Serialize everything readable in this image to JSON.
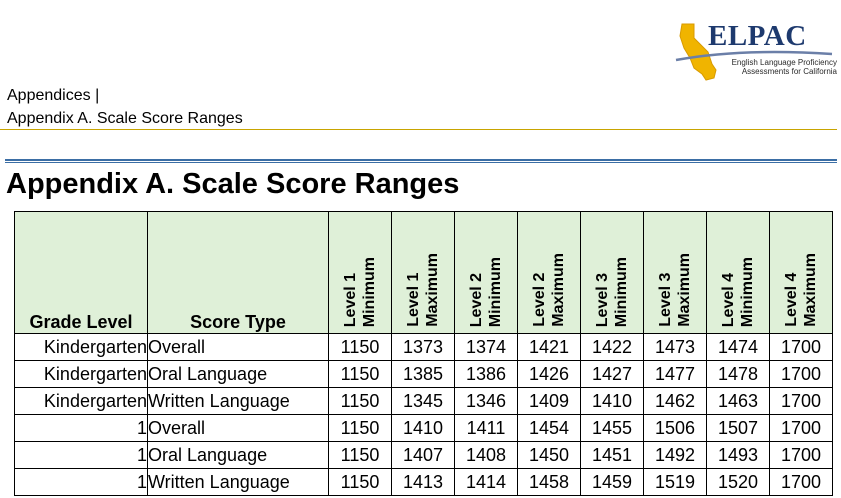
{
  "logo": {
    "name": "ELPAC",
    "subtitle_line1": "English Language Proficiency",
    "subtitle_line2": "Assessments for California",
    "colors": {
      "text": "#1e3a6e",
      "state": "#f0b400",
      "swoosh": "#6b7fa8"
    }
  },
  "header": {
    "line1": "Appendices |",
    "line2": "Appendix A. Scale Score Ranges",
    "rule_color": "#c8a400"
  },
  "page_title": "Appendix A. Scale Score Ranges",
  "table": {
    "header_bg": "#dff0d8",
    "columns": {
      "grade": "Grade Level",
      "type": "Score Type",
      "levels": [
        "Level 1\nMinimum",
        "Level 1\nMaximum",
        "Level 2\nMinimum",
        "Level 2\nMaximum",
        "Level 3\nMinimum",
        "Level 3\nMaximum",
        "Level 4\nMinimum",
        "Level 4\nMaximum"
      ]
    },
    "rows": [
      {
        "grade": "Kindergarten",
        "type": "Overall",
        "values": [
          "1150",
          "1373",
          "1374",
          "1421",
          "1422",
          "1473",
          "1474",
          "1700"
        ]
      },
      {
        "grade": "Kindergarten",
        "type": "Oral Language",
        "values": [
          "1150",
          "1385",
          "1386",
          "1426",
          "1427",
          "1477",
          "1478",
          "1700"
        ]
      },
      {
        "grade": "Kindergarten",
        "type": "Written Language",
        "values": [
          "1150",
          "1345",
          "1346",
          "1409",
          "1410",
          "1462",
          "1463",
          "1700"
        ]
      },
      {
        "grade": "1",
        "type": "Overall",
        "values": [
          "1150",
          "1410",
          "1411",
          "1454",
          "1455",
          "1506",
          "1507",
          "1700"
        ]
      },
      {
        "grade": "1",
        "type": "Oral Language",
        "values": [
          "1150",
          "1407",
          "1408",
          "1450",
          "1451",
          "1492",
          "1493",
          "1700"
        ]
      },
      {
        "grade": "1",
        "type": "Written Language",
        "values": [
          "1150",
          "1413",
          "1414",
          "1458",
          "1459",
          "1519",
          "1520",
          "1700"
        ]
      }
    ]
  }
}
